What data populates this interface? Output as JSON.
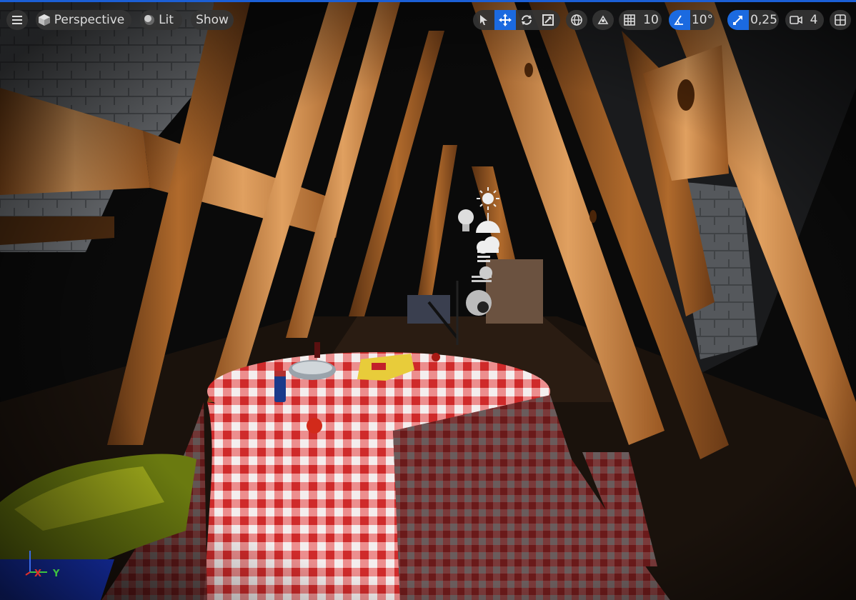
{
  "toolbar": {
    "menu_icon": "hamburger-icon",
    "view_mode": "Perspective",
    "lighting_mode": "Lit",
    "show_label": "Show",
    "transform_tools": [
      "select-arrow-icon",
      "move-icon",
      "rotate-icon",
      "scale-icon"
    ],
    "active_tool": "move-icon",
    "grid_snap_value": "10",
    "rotation_snap_value": "10°",
    "scale_snap_value": "0,25",
    "camera_speed_value": "4"
  },
  "scene_icons": [
    "sun-icon",
    "lightbulb-icon",
    "sky-dome-icon",
    "cloud-icon",
    "fog-icon",
    "reflection-sphere-icon"
  ],
  "axis": {
    "x_label": "X",
    "y_label": "Y",
    "x_color": "#e0302a",
    "y_color": "#3fc23f",
    "z_color": "#3a6ae8"
  },
  "colors": {
    "accent": "#1b6ae0",
    "toolbar_bg": "#343434",
    "border": "#1b5fd6"
  }
}
